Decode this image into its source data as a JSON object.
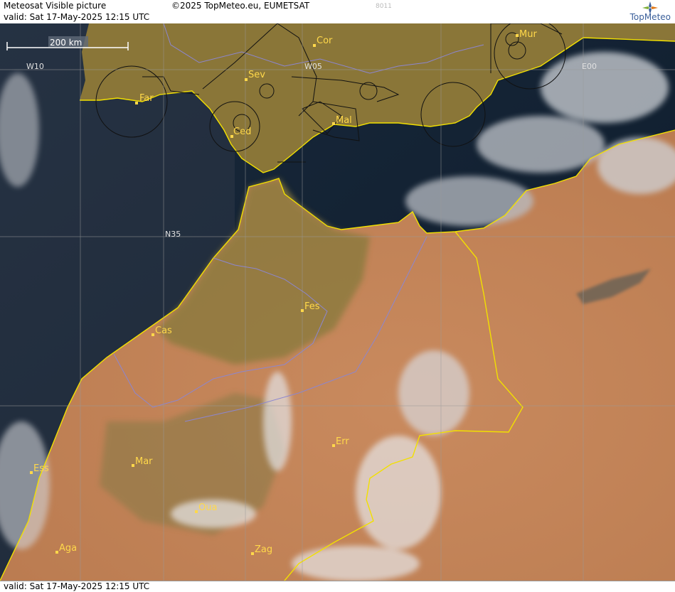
{
  "header": {
    "title": "Meteosat Visible picture",
    "valid": "valid:  Sat  17-May-2025  12:15 UTC",
    "copyright": "©2025 TopMeteo.eu, EUMETSAT",
    "code": "8011",
    "brand": "TopMeteo"
  },
  "footer": {
    "valid": "valid:  Sat  17-May-2025  12:15 UTC"
  },
  "map": {
    "scale_label": "200 km",
    "grid_labels": {
      "w10": "W10",
      "w05": "W05",
      "e00": "E00",
      "n35": "N35"
    },
    "cities": {
      "far": "Far",
      "sev": "Sev",
      "cor": "Cor",
      "mur": "Mur",
      "ced": "Ced",
      "mal": "Mal",
      "fes": "Fes",
      "cas": "Cas",
      "err": "Err",
      "ess": "Ess",
      "mar": "Mar",
      "oua": "Oua",
      "aga": "Aga",
      "zag": "Zag"
    }
  },
  "colors": {
    "sea": "#0f1f30",
    "land_spain": "#8a7638",
    "land_north_morocco": "#8a7a3c",
    "desert": "#c2835a",
    "coastline": "#f2e000",
    "border": "#8c86d0",
    "city": "#ffd84a",
    "cloud": "#e8e8ea"
  }
}
